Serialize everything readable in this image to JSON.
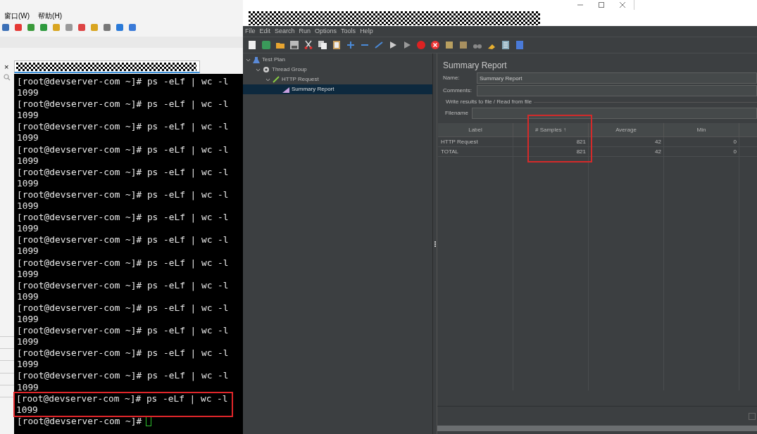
{
  "back_window": {
    "menu": [
      "窗口(W)",
      "帮助(H)"
    ]
  },
  "terminal": {
    "tab_close": "×",
    "entries": [
      {
        "command": "[root@devserver-com ~]# ps -eLf | wc -l",
        "output": "1099",
        "highlighted": false
      },
      {
        "command": "[root@devserver-com ~]# ps -eLf | wc -l",
        "output": "1099",
        "highlighted": false
      },
      {
        "command": "[root@devserver-com ~]# ps -eLf | wc -l",
        "output": "1099",
        "highlighted": false
      },
      {
        "command": "[root@devserver-com ~]# ps -eLf | wc -l",
        "output": "1099",
        "highlighted": false
      },
      {
        "command": "[root@devserver-com ~]# ps -eLf | wc -l",
        "output": "1099",
        "highlighted": false
      },
      {
        "command": "[root@devserver-com ~]# ps -eLf | wc -l",
        "output": "1099",
        "highlighted": false
      },
      {
        "command": "[root@devserver-com ~]# ps -eLf | wc -l",
        "output": "1099",
        "highlighted": false
      },
      {
        "command": "[root@devserver-com ~]# ps -eLf | wc -l",
        "output": "1099",
        "highlighted": false
      },
      {
        "command": "[root@devserver-com ~]# ps -eLf | wc -l",
        "output": "1099",
        "highlighted": false
      },
      {
        "command": "[root@devserver-com ~]# ps -eLf | wc -l",
        "output": "1099",
        "highlighted": false
      },
      {
        "command": "[root@devserver-com ~]# ps -eLf | wc -l",
        "output": "1099",
        "highlighted": false
      },
      {
        "command": "[root@devserver-com ~]# ps -eLf | wc -l",
        "output": "1099",
        "highlighted": false
      },
      {
        "command": "[root@devserver-com ~]# ps -eLf | wc -l",
        "output": "1099",
        "highlighted": false
      },
      {
        "command": "[root@devserver-com ~]# ps -eLf | wc -l",
        "output": "1099",
        "highlighted": false
      },
      {
        "command": "[root@devserver-com ~]# ps -eLf | wc -l",
        "output": "1099",
        "highlighted": true
      }
    ],
    "prompt": "[root@devserver-com ~]#"
  },
  "jmeter": {
    "menu": [
      "File",
      "Edit",
      "Search",
      "Run",
      "Options",
      "Tools",
      "Help"
    ],
    "tree": [
      {
        "label": "Test Plan",
        "kind": "plan",
        "expanded": true,
        "selected": false,
        "children": [
          {
            "label": "Thread Group",
            "kind": "group",
            "expanded": true,
            "selected": false,
            "children": [
              {
                "label": "HTTP Request",
                "kind": "request",
                "expanded": true,
                "selected": false,
                "children": [
                  {
                    "label": "Summary Report",
                    "kind": "report",
                    "selected": true
                  }
                ]
              }
            ]
          }
        ]
      }
    ],
    "panel": {
      "title": "Summary Report",
      "name_label": "Name:",
      "name_value": "Summary Report",
      "comments_label": "Comments:",
      "file_section": "Write results to file / Read from file",
      "filename_label": "Filename"
    },
    "checkbox": {
      "checked": false
    },
    "table": {
      "columns": [
        {
          "label": "Label",
          "highlighted": false
        },
        {
          "label": "# Samples ↑",
          "highlighted": true
        },
        {
          "label": "Average",
          "highlighted": false
        },
        {
          "label": "Min",
          "highlighted": false
        }
      ],
      "rows": [
        [
          "HTTP Request",
          "821",
          "42",
          "0"
        ],
        [
          "TOTAL",
          "821",
          "42",
          "0"
        ]
      ]
    }
  }
}
